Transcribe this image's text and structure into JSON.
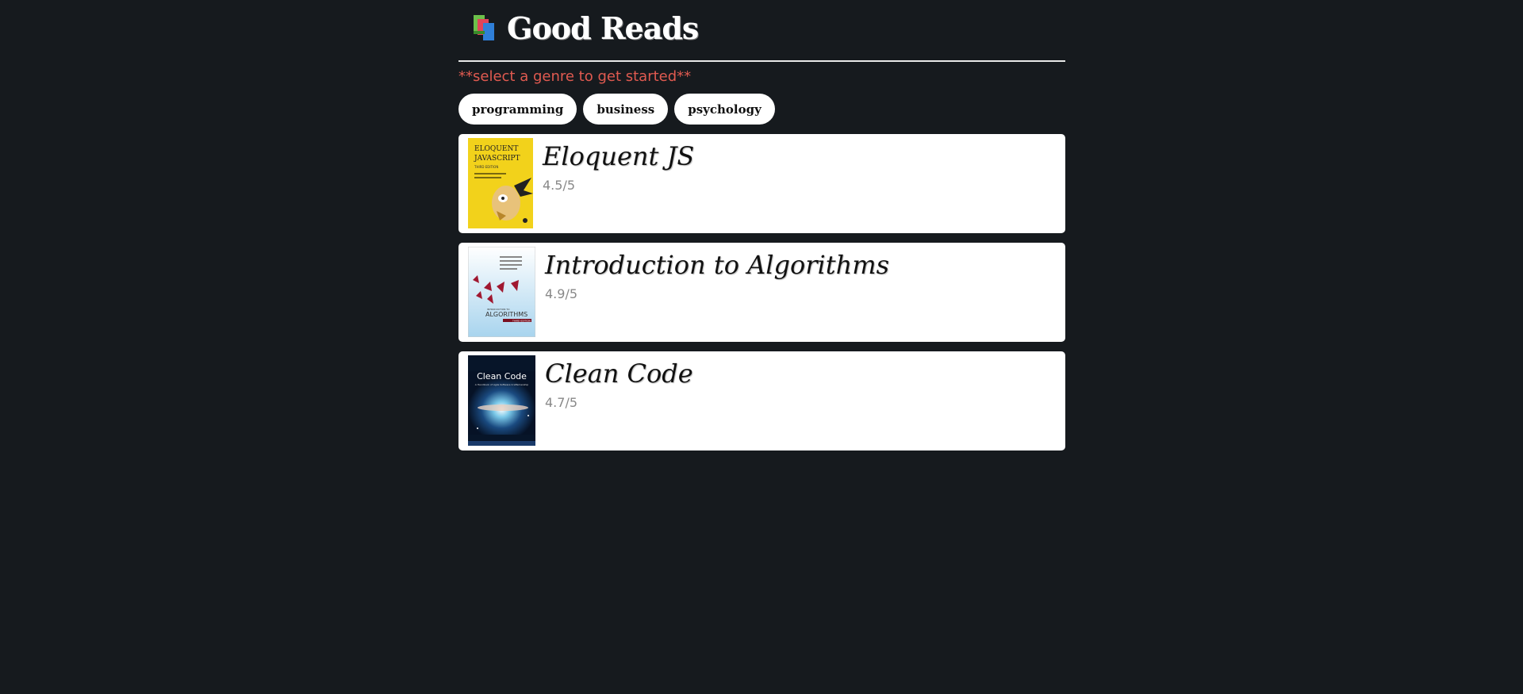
{
  "header": {
    "logo_icon": "books-icon",
    "title": "Good Reads"
  },
  "hint": "**select a genre to get started**",
  "genres": [
    {
      "label": "programming"
    },
    {
      "label": "business"
    },
    {
      "label": "psychology"
    }
  ],
  "books": [
    {
      "title": "Eloquent JS",
      "rating": "4.5/5",
      "cover_icon": "eloquent-javascript-cover",
      "cover_color": "#f2d21b",
      "cover_text": [
        "ELOQUENT",
        "JAVASCRIPT",
        "THIRD EDITION"
      ]
    },
    {
      "title": "Introduction to Algorithms",
      "rating": "4.9/5",
      "cover_icon": "introduction-to-algorithms-cover",
      "cover_color": "#cfe6f3",
      "cover_text": [
        "ALGORITHMS",
        "INTRODUCTION TO",
        "THIRD EDITION"
      ]
    },
    {
      "title": "Clean Code",
      "rating": "4.7/5",
      "cover_icon": "clean-code-cover",
      "cover_color": "#0b1d3a",
      "cover_text": [
        "Clean Code",
        "A Handbook of Agile Software Craftsmanship"
      ]
    }
  ]
}
